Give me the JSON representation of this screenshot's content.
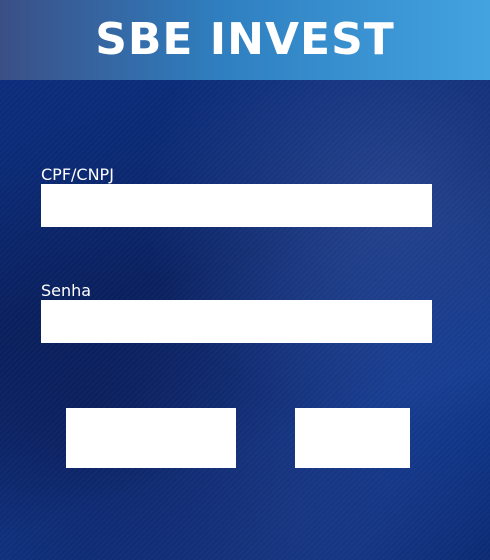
{
  "header": {
    "title": "SBE INVEST"
  },
  "form": {
    "document": {
      "label": "CPF/CNPJ",
      "value": "",
      "placeholder": ""
    },
    "password": {
      "label": "Senha",
      "value": "",
      "placeholder": ""
    },
    "primary_button_label": "",
    "secondary_button_label": ""
  }
}
